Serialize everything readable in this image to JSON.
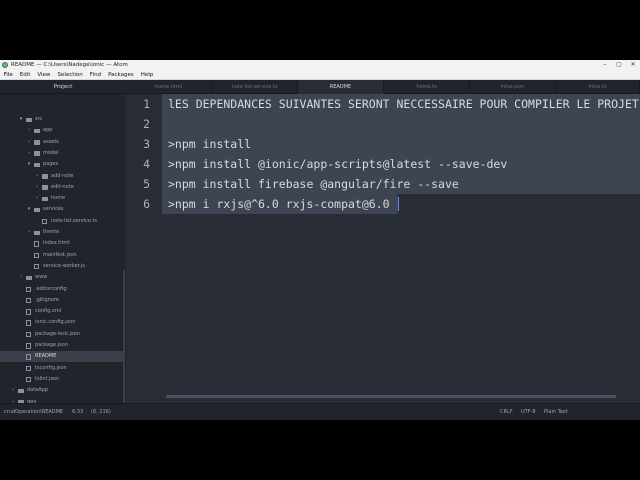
{
  "window": {
    "title": "README — C:\\Users\\Nadege\\ionic — Atom",
    "controls": {
      "minimize": "–",
      "maximize": "▢",
      "close": "✕"
    }
  },
  "menu": [
    "File",
    "Edit",
    "View",
    "Selection",
    "Find",
    "Packages",
    "Help"
  ],
  "sidebar": {
    "header": "Project",
    "items": [
      {
        "label": "src",
        "type": "folder",
        "expanded": true,
        "depth": 0
      },
      {
        "label": "app",
        "type": "folder",
        "expanded": false,
        "depth": 1
      },
      {
        "label": "assets",
        "type": "folder",
        "expanded": false,
        "depth": 1
      },
      {
        "label": "model",
        "type": "folder",
        "expanded": false,
        "depth": 1
      },
      {
        "label": "pages",
        "type": "folder",
        "expanded": true,
        "depth": 1
      },
      {
        "label": "add-note",
        "type": "folder",
        "expanded": false,
        "depth": 2
      },
      {
        "label": "edit-note",
        "type": "folder",
        "expanded": false,
        "depth": 2
      },
      {
        "label": "home",
        "type": "folder",
        "expanded": false,
        "depth": 2
      },
      {
        "label": "services",
        "type": "folder",
        "expanded": true,
        "depth": 1
      },
      {
        "label": "note-list.service.ts",
        "type": "file",
        "depth": 2
      },
      {
        "label": "theme",
        "type": "folder",
        "expanded": false,
        "depth": 1
      },
      {
        "label": "index.html",
        "type": "file",
        "depth": 1
      },
      {
        "label": "manifest.json",
        "type": "file",
        "depth": 1
      },
      {
        "label": "service-worker.js",
        "type": "file",
        "depth": 1
      },
      {
        "label": "www",
        "type": "folder",
        "expanded": false,
        "depth": 0
      },
      {
        "label": ".editorconfig",
        "type": "file",
        "depth": 0
      },
      {
        "label": ".gitignore",
        "type": "file",
        "depth": 0
      },
      {
        "label": "config.xml",
        "type": "file",
        "depth": 0
      },
      {
        "label": "ionic.config.json",
        "type": "file",
        "depth": 0
      },
      {
        "label": "package-lock.json",
        "type": "file",
        "depth": 0
      },
      {
        "label": "package.json",
        "type": "file",
        "depth": 0
      },
      {
        "label": "README",
        "type": "file",
        "depth": 0,
        "selected": true
      },
      {
        "label": "tsconfig.json",
        "type": "file",
        "depth": 0
      },
      {
        "label": "tslint.json",
        "type": "file",
        "depth": 0
      },
      {
        "label": "dateApp",
        "type": "folder",
        "expanded": false,
        "depth": -1
      },
      {
        "label": "geo",
        "type": "folder",
        "expanded": false,
        "depth": -1
      },
      {
        "label": "Login-Register-using-php-MySQL-in-",
        "type": "folder",
        "expanded": false,
        "depth": -1
      }
    ]
  },
  "tabs": [
    {
      "label": "home.html",
      "active": false
    },
    {
      "label": "note-list.service.ts",
      "active": false
    },
    {
      "label": "README",
      "active": true
    },
    {
      "label": "home.ts",
      "active": false
    },
    {
      "label": "infos.json",
      "active": false
    },
    {
      "label": "infos.ts",
      "active": false
    }
  ],
  "editor": {
    "lines": [
      {
        "n": "1",
        "text": "lES DEPENDANCES SUIVANTES SERONT NECCESSAIRE POUR COMPILER LE PROJET"
      },
      {
        "n": "2",
        "text": ""
      },
      {
        "n": "3",
        "text": ">npm install"
      },
      {
        "n": "4",
        "text": ">npm install @ionic/app-scripts@latest --save-dev"
      },
      {
        "n": "5",
        "text": ">npm install firebase @angular/fire --save"
      },
      {
        "n": "6",
        "text": ">npm i rxjs@^6.0 rxjs-compat@6.0"
      }
    ]
  },
  "status": {
    "path": "crudOperation\\README",
    "cursor": "6:33",
    "selection": "(6, 216)",
    "line_ending": "CRLF",
    "encoding": "UTF-8",
    "grammar": "Plain Text"
  }
}
